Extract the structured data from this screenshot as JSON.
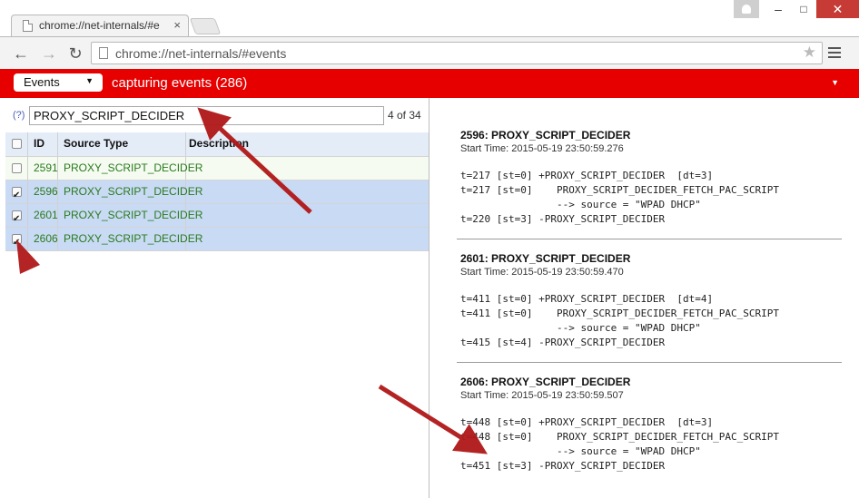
{
  "window": {
    "tab_title": "chrome://net-internals/#e",
    "tab_close": "×",
    "win_min": "–",
    "win_max": "□",
    "win_close": "✕"
  },
  "toolbar": {
    "url": "chrome://net-internals/#events",
    "back_glyph": "←",
    "fwd_glyph": "→",
    "reload_glyph": "↻",
    "star_glyph": "★"
  },
  "statusbar": {
    "view_selected": "Events",
    "select_arrow": "▼",
    "capture_text": "capturing events (286)",
    "menu_arrow": "▼"
  },
  "filter": {
    "help": "(?)",
    "value": "PROXY_SCRIPT_DECIDER",
    "count": "4 of 34"
  },
  "table": {
    "headers": {
      "id": "ID",
      "source_type": "Source Type",
      "description": "Description"
    },
    "rows": [
      {
        "id": "2591",
        "source_type": "PROXY_SCRIPT_DECIDER",
        "description": "",
        "checked": false
      },
      {
        "id": "2596",
        "source_type": "PROXY_SCRIPT_DECIDER",
        "description": "",
        "checked": true
      },
      {
        "id": "2601",
        "source_type": "PROXY_SCRIPT_DECIDER",
        "description": "",
        "checked": true
      },
      {
        "id": "2606",
        "source_type": "PROXY_SCRIPT_DECIDER",
        "description": "",
        "checked": true
      }
    ]
  },
  "details": [
    {
      "title": "2596: PROXY_SCRIPT_DECIDER",
      "start": "Start Time: 2015-05-19 23:50:59.276",
      "log": "t=217 [st=0] +PROXY_SCRIPT_DECIDER  [dt=3]\nt=217 [st=0]    PROXY_SCRIPT_DECIDER_FETCH_PAC_SCRIPT\n                --> source = \"WPAD DHCP\"\nt=220 [st=3] -PROXY_SCRIPT_DECIDER"
    },
    {
      "title": "2601: PROXY_SCRIPT_DECIDER",
      "start": "Start Time: 2015-05-19 23:50:59.470",
      "log": "t=411 [st=0] +PROXY_SCRIPT_DECIDER  [dt=4]\nt=411 [st=0]    PROXY_SCRIPT_DECIDER_FETCH_PAC_SCRIPT\n                --> source = \"WPAD DHCP\"\nt=415 [st=4] -PROXY_SCRIPT_DECIDER"
    },
    {
      "title": "2606: PROXY_SCRIPT_DECIDER",
      "start": "Start Time: 2015-05-19 23:50:59.507",
      "log": "t=448 [st=0] +PROXY_SCRIPT_DECIDER  [dt=3]\nt=448 [st=0]    PROXY_SCRIPT_DECIDER_FETCH_PAC_SCRIPT\n                --> source = \"WPAD DHCP\"\nt=451 [st=3] -PROXY_SCRIPT_DECIDER"
    }
  ],
  "colors": {
    "status_bar": "#e60000",
    "selected_row": "#c9daf4",
    "source_text": "#2a7a1e",
    "annotation_arrow": "#b01818"
  }
}
